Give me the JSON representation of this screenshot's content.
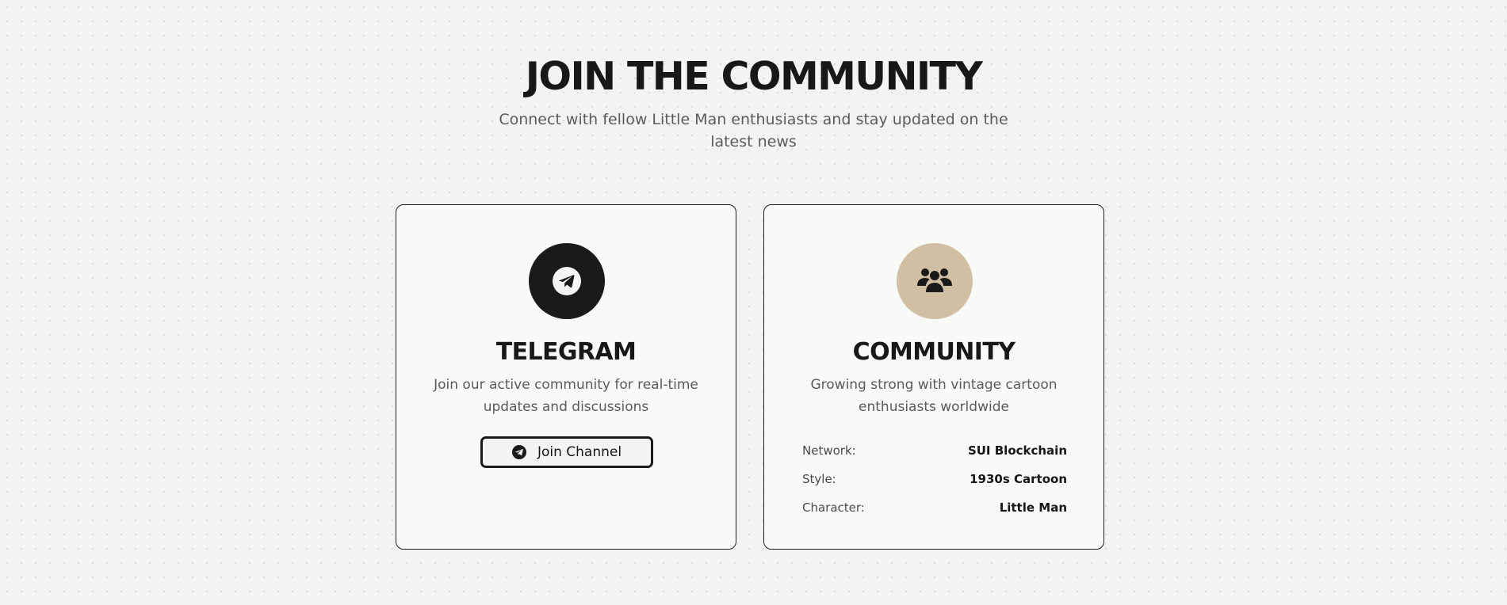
{
  "header": {
    "title": "JOIN THE COMMUNITY",
    "subtitle": "Connect with fellow Little Man enthusiasts and stay updated on the latest news"
  },
  "cards": [
    {
      "icon": "telegram-icon",
      "title": "TELEGRAM",
      "description": "Join our active community for real-time updates and discussions",
      "button_label": "Join Channel",
      "button_icon": "telegram-icon",
      "accent": "#1a1a1a"
    },
    {
      "icon": "users-icon",
      "title": "COMMUNITY",
      "description": "Growing strong with vintage cartoon enthusiasts worldwide",
      "accent": "#d1bfa4",
      "details": [
        {
          "label": "Network:",
          "value": "SUI Blockchain"
        },
        {
          "label": "Style:",
          "value": "1930s Cartoon"
        },
        {
          "label": "Character:",
          "value": "Little Man"
        }
      ]
    }
  ],
  "colors": {
    "background": "#f4f3f1",
    "card_background": "#f9f9f8",
    "text": "#161616",
    "muted_text": "#5a5a5a"
  }
}
